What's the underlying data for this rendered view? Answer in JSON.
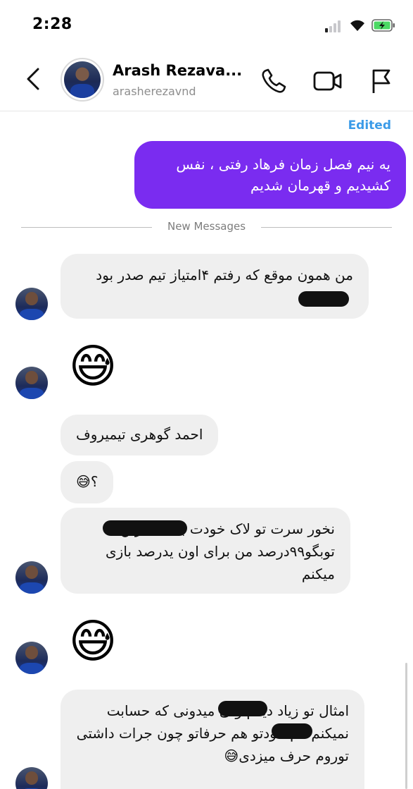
{
  "status_bar": {
    "time": "2:28"
  },
  "header": {
    "contact_name": "Arash Rezava...",
    "contact_handle": "arasherezavnd",
    "icons": [
      "back-icon",
      "phone-icon",
      "video-icon",
      "flag-icon"
    ]
  },
  "messages": {
    "edited_label": "Edited",
    "outgoing_text": "یه نیم فصل زمان فرهاد رفتی ، نفس کشیدیم و قهرمان شدیم",
    "new_messages_label": "New Messages",
    "incoming": [
      {
        "text": "من همون موقع که رفتم ۴امتیاز تیم صدر بود"
      },
      {
        "emoji": "😅"
      },
      {
        "text": "احمد گوهری تیمیروف"
      },
      {
        "text": "؟😅"
      },
      {
        "text": "نخور سرت تو لاک خودت باشه افرین توبگو۹۹درصد من برای اون یدرصد بازی میکنم"
      },
      {
        "emoji": "😅"
      },
      {
        "text": "امثال تو زیاد دیدم ولی میدونی که حسابت نمیکنم هم خودتو هم حرفاتو چون جرات داشتی توروم حرف میزدی😅"
      }
    ]
  },
  "colors": {
    "outgoing_bubble": "#7a2cf0",
    "incoming_bubble": "#efefef",
    "edited_label": "#3b9be8"
  }
}
